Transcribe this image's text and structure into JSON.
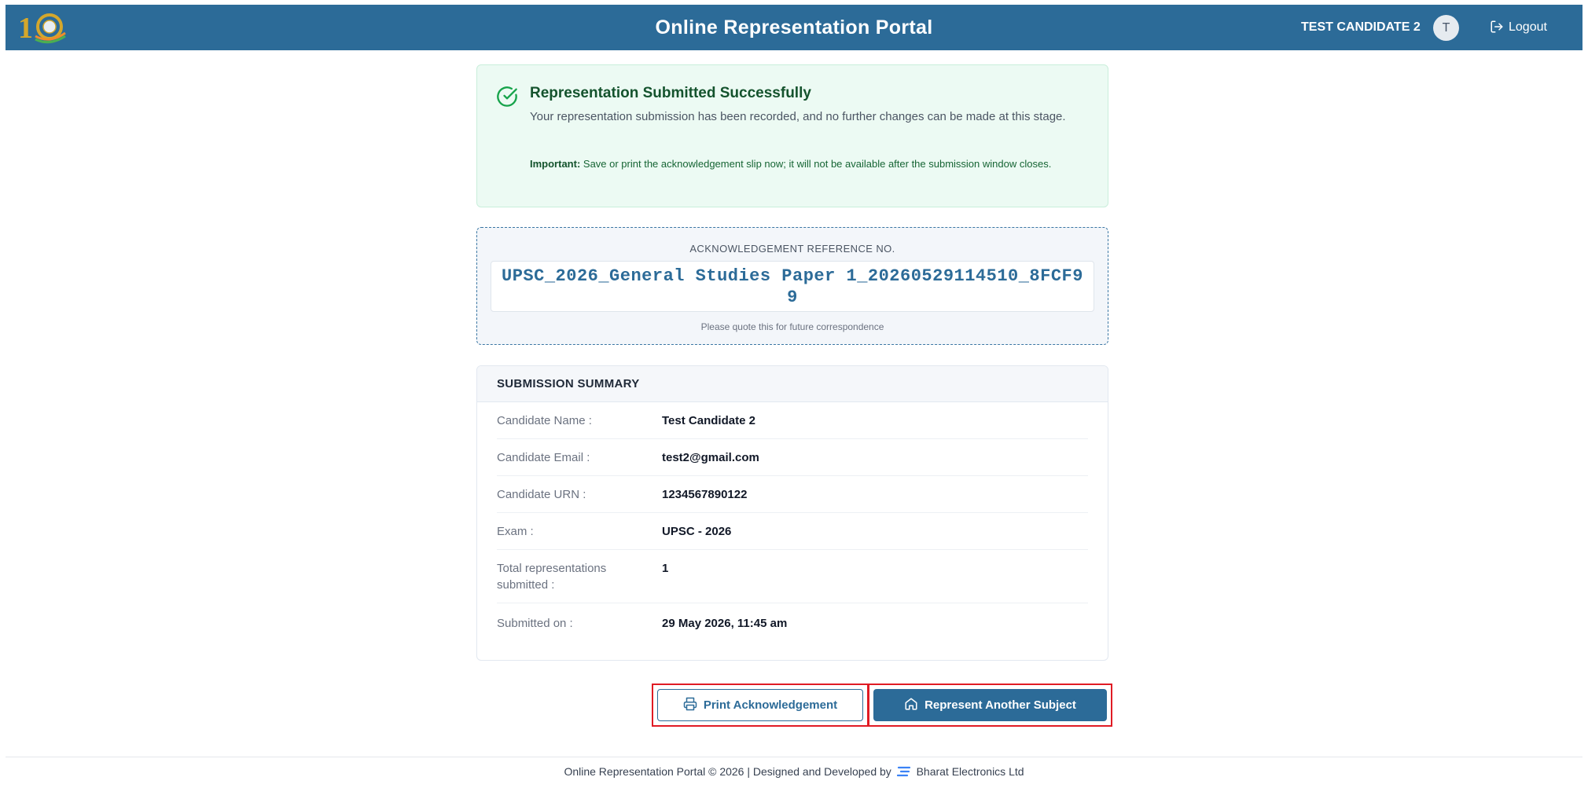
{
  "header": {
    "title": "Online Representation Portal",
    "user_name": "TEST CANDIDATE 2",
    "avatar_initial": "T",
    "logout_label": "Logout"
  },
  "success": {
    "title": "Representation Submitted Successfully",
    "message": "Your representation submission has been recorded, and no further changes can be made at this stage.",
    "important_label": "Important:",
    "important_text": " Save or print the acknowledgement slip now; it will not be available after the submission window closes."
  },
  "reference": {
    "label": "ACKNOWLEDGEMENT REFERENCE NO.",
    "value": "UPSC_2026_General Studies Paper 1_20260529114510_8FCF99",
    "note": "Please quote this for future correspondence"
  },
  "summary": {
    "heading": "SUBMISSION SUMMARY",
    "rows": [
      {
        "label": "Candidate Name :",
        "value": "Test Candidate 2"
      },
      {
        "label": "Candidate Email :",
        "value": "test2@gmail.com"
      },
      {
        "label": "Candidate URN :",
        "value": "1234567890122"
      },
      {
        "label": "Exam :",
        "value": "UPSC - 2026"
      },
      {
        "label": "Total representations submitted :",
        "value": "1"
      },
      {
        "label": "Submitted on :",
        "value": "29 May 2026, 11:45 am"
      }
    ]
  },
  "actions": {
    "print_label": "Print Acknowledgement",
    "another_label": "Represent Another Subject"
  },
  "footer": {
    "text_before": "Online Representation Portal © 2026 | Designed and Developed by",
    "company": "Bharat Electronics Ltd"
  },
  "colors": {
    "primary": "#2c6b98",
    "success_bg": "#ecfaf3",
    "success_text": "#14532d",
    "highlight": "#e01b24"
  }
}
